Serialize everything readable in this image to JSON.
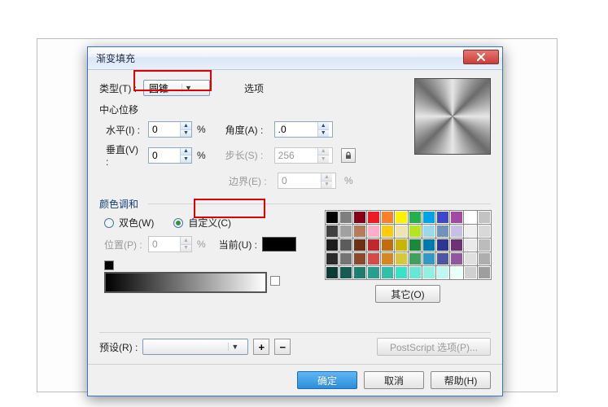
{
  "dialog": {
    "title": "渐变填充",
    "type_label": "类型(T) :",
    "type_value": "圆锥",
    "options_label": "选项",
    "center_offset_label": "中心位移",
    "horiz_label": "水平(I) :",
    "horiz_value": "0",
    "vert_label": "垂直(V) :",
    "vert_value": "0",
    "percent": "%",
    "angle_label": "角度(A) :",
    "angle_value": ".0",
    "step_label": "步长(S) :",
    "step_value": "256",
    "edge_label": "边界(E) :",
    "edge_value": "0",
    "blend_label": "颜色调和",
    "radio_two": "双色(W)",
    "radio_custom": "自定义(C)",
    "pos_label": "位置(P) :",
    "pos_value": "0",
    "current_label": "当前(U) :",
    "other_btn": "其它(O)",
    "preset_label": "预设(R) :",
    "postscript_btn": "PostScript 选项(P)...",
    "ok": "确定",
    "cancel": "取消",
    "help": "帮助(H)"
  },
  "palette": [
    [
      "#000000",
      "#7f7f7f",
      "#880015",
      "#ed1c24",
      "#ff7f27",
      "#fff200",
      "#22b14c",
      "#00a2e8",
      "#3f48cc",
      "#a349a4",
      "#ffffff",
      "#c3c3c3"
    ],
    [
      "#404040",
      "#a0a0a0",
      "#b97a57",
      "#ffaec9",
      "#ffc90e",
      "#efe4b0",
      "#b5e61d",
      "#99d9ea",
      "#7092be",
      "#c8bfe7",
      "#f0f0f0",
      "#d8d8d8"
    ],
    [
      "#1b1b1b",
      "#5c5c5c",
      "#6e2f12",
      "#c1272d",
      "#c46b0d",
      "#c9b500",
      "#1a8a3a",
      "#0079ad",
      "#2d3595",
      "#6e3175",
      "#eaeaea",
      "#bcbcbc"
    ],
    [
      "#2b2b2b",
      "#747474",
      "#8c4a2b",
      "#d64a4a",
      "#d8861f",
      "#d6c83a",
      "#3fa15b",
      "#3199c4",
      "#4e55a5",
      "#8e57a0",
      "#dfdfdf",
      "#aeaeae"
    ],
    [
      "#0d3b36",
      "#165c53",
      "#1f7d70",
      "#289e8d",
      "#31bfaa",
      "#3ae0c7",
      "#66e8d4",
      "#92f0e1",
      "#bef8ee",
      "#e9fffa",
      "#d0d0d0",
      "#9e9e9e"
    ]
  ]
}
